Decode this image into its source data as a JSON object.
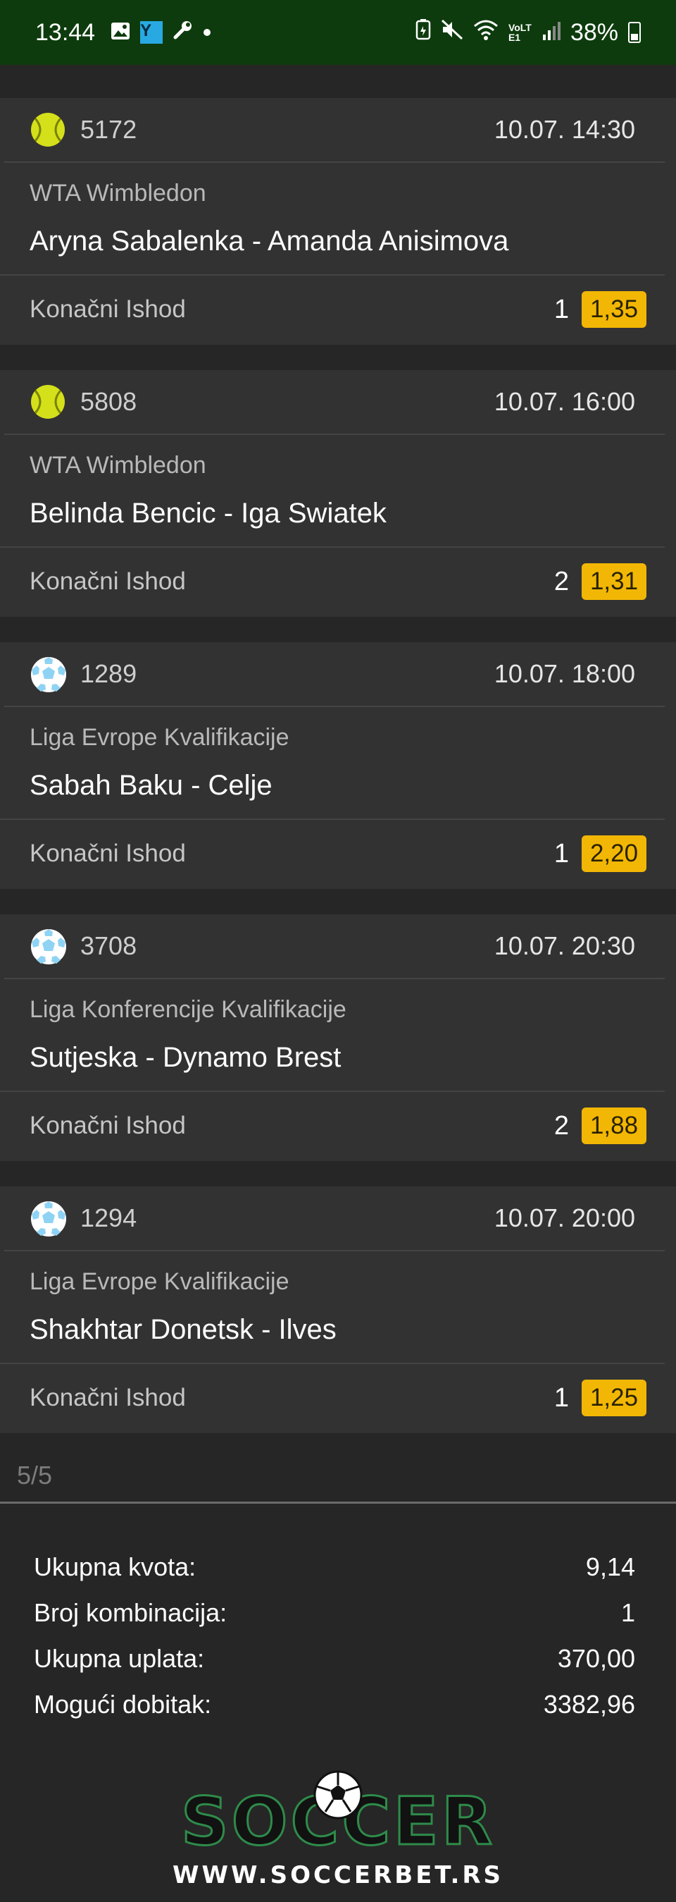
{
  "status_bar": {
    "time": "13:44",
    "battery": "38%",
    "network": "VoLTE1",
    "icons": [
      "image-icon",
      "y-app-icon",
      "tool-icon",
      "dot-icon",
      "battery-saver-icon",
      "mute-icon",
      "wifi-icon",
      "signal-icon",
      "battery-icon"
    ],
    "y_badge": "Y"
  },
  "matches": [
    {
      "sport": "tennis",
      "id": "5172",
      "date": "10.07. 14:30",
      "league": "WTA Wimbledon",
      "teams": "Aryna Sabalenka - Amanda Anisimova",
      "market": "Konačni Ishod",
      "pick": "1",
      "odd": "1,35"
    },
    {
      "sport": "tennis",
      "id": "5808",
      "date": "10.07. 16:00",
      "league": "WTA Wimbledon",
      "teams": "Belinda Bencic - Iga Swiatek",
      "market": "Konačni Ishod",
      "pick": "2",
      "odd": "1,31"
    },
    {
      "sport": "football",
      "id": "1289",
      "date": "10.07. 18:00",
      "league": "Liga Evrope Kvalifikacije",
      "teams": "Sabah Baku - Celje",
      "market": "Konačni Ishod",
      "pick": "1",
      "odd": "2,20"
    },
    {
      "sport": "football",
      "id": "3708",
      "date": "10.07. 20:30",
      "league": "Liga Konferencije Kvalifikacije",
      "teams": "Sutjeska - Dynamo Brest",
      "market": "Konačni Ishod",
      "pick": "2",
      "odd": "1,88"
    },
    {
      "sport": "football",
      "id": "1294",
      "date": "10.07. 20:00",
      "league": "Liga Evrope Kvalifikacije",
      "teams": "Shakhtar Donetsk - Ilves",
      "market": "Konačni Ishod",
      "pick": "1",
      "odd": "1,25"
    }
  ],
  "count": "5/5",
  "summary": [
    {
      "label": "Ukupna kvota:",
      "value": "9,14"
    },
    {
      "label": "Broj kombinacija:",
      "value": "1"
    },
    {
      "label": "Ukupna uplata:",
      "value": "370,00"
    },
    {
      "label": "Mogući dobitak:",
      "value": "3382,96"
    }
  ],
  "logo": {
    "word": "SOCCER",
    "url": "WWW.SOCCERBET.RS"
  },
  "colors": {
    "status_bar": "#0d3b0d",
    "card": "#323232",
    "odd_badge": "#f2b705",
    "tennis_ball": "#d4e01a",
    "football": "#8fd3f4"
  }
}
